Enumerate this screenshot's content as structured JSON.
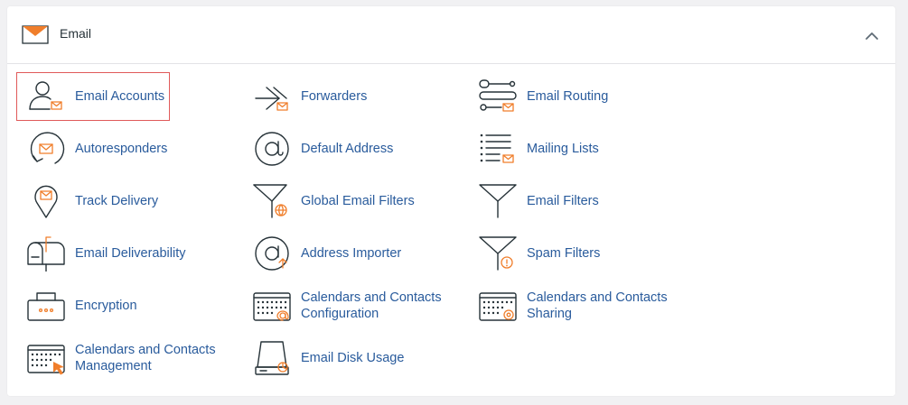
{
  "section": {
    "title": "Email",
    "header_icon": "envelope-icon",
    "collapse_icon": "chevron-up-icon"
  },
  "colors": {
    "link": "#295b9c",
    "accent": "#f07e2b",
    "selection_border": "#e05a5a"
  },
  "items": [
    {
      "label": "Email Accounts",
      "icon": "user-mail-icon"
    },
    {
      "label": "Forwarders",
      "icon": "forward-arrow-icon"
    },
    {
      "label": "Email Routing",
      "icon": "routing-icon"
    },
    {
      "label": "Autoresponders",
      "icon": "autoresponder-icon"
    },
    {
      "label": "Default Address",
      "icon": "at-sign-icon"
    },
    {
      "label": "Mailing Lists",
      "icon": "list-mail-icon"
    },
    {
      "label": "Track Delivery",
      "icon": "location-pin-icon"
    },
    {
      "label": "Global Email Filters",
      "icon": "funnel-globe-icon"
    },
    {
      "label": "Email Filters",
      "icon": "funnel-icon"
    },
    {
      "label": "Email Deliverability",
      "icon": "mailbox-icon"
    },
    {
      "label": "Address Importer",
      "icon": "at-import-icon"
    },
    {
      "label": "Spam Filters",
      "icon": "funnel-warning-icon"
    },
    {
      "label": "Encryption",
      "icon": "lock-box-icon"
    },
    {
      "label": "Calendars and Contacts Configuration",
      "icon": "calendar-at-icon"
    },
    {
      "label": "Calendars and Contacts Sharing",
      "icon": "calendar-share-icon"
    },
    {
      "label": "Calendars and Contacts Management",
      "icon": "calendar-cursor-icon"
    },
    {
      "label": "Email Disk Usage",
      "icon": "disk-usage-icon"
    }
  ]
}
